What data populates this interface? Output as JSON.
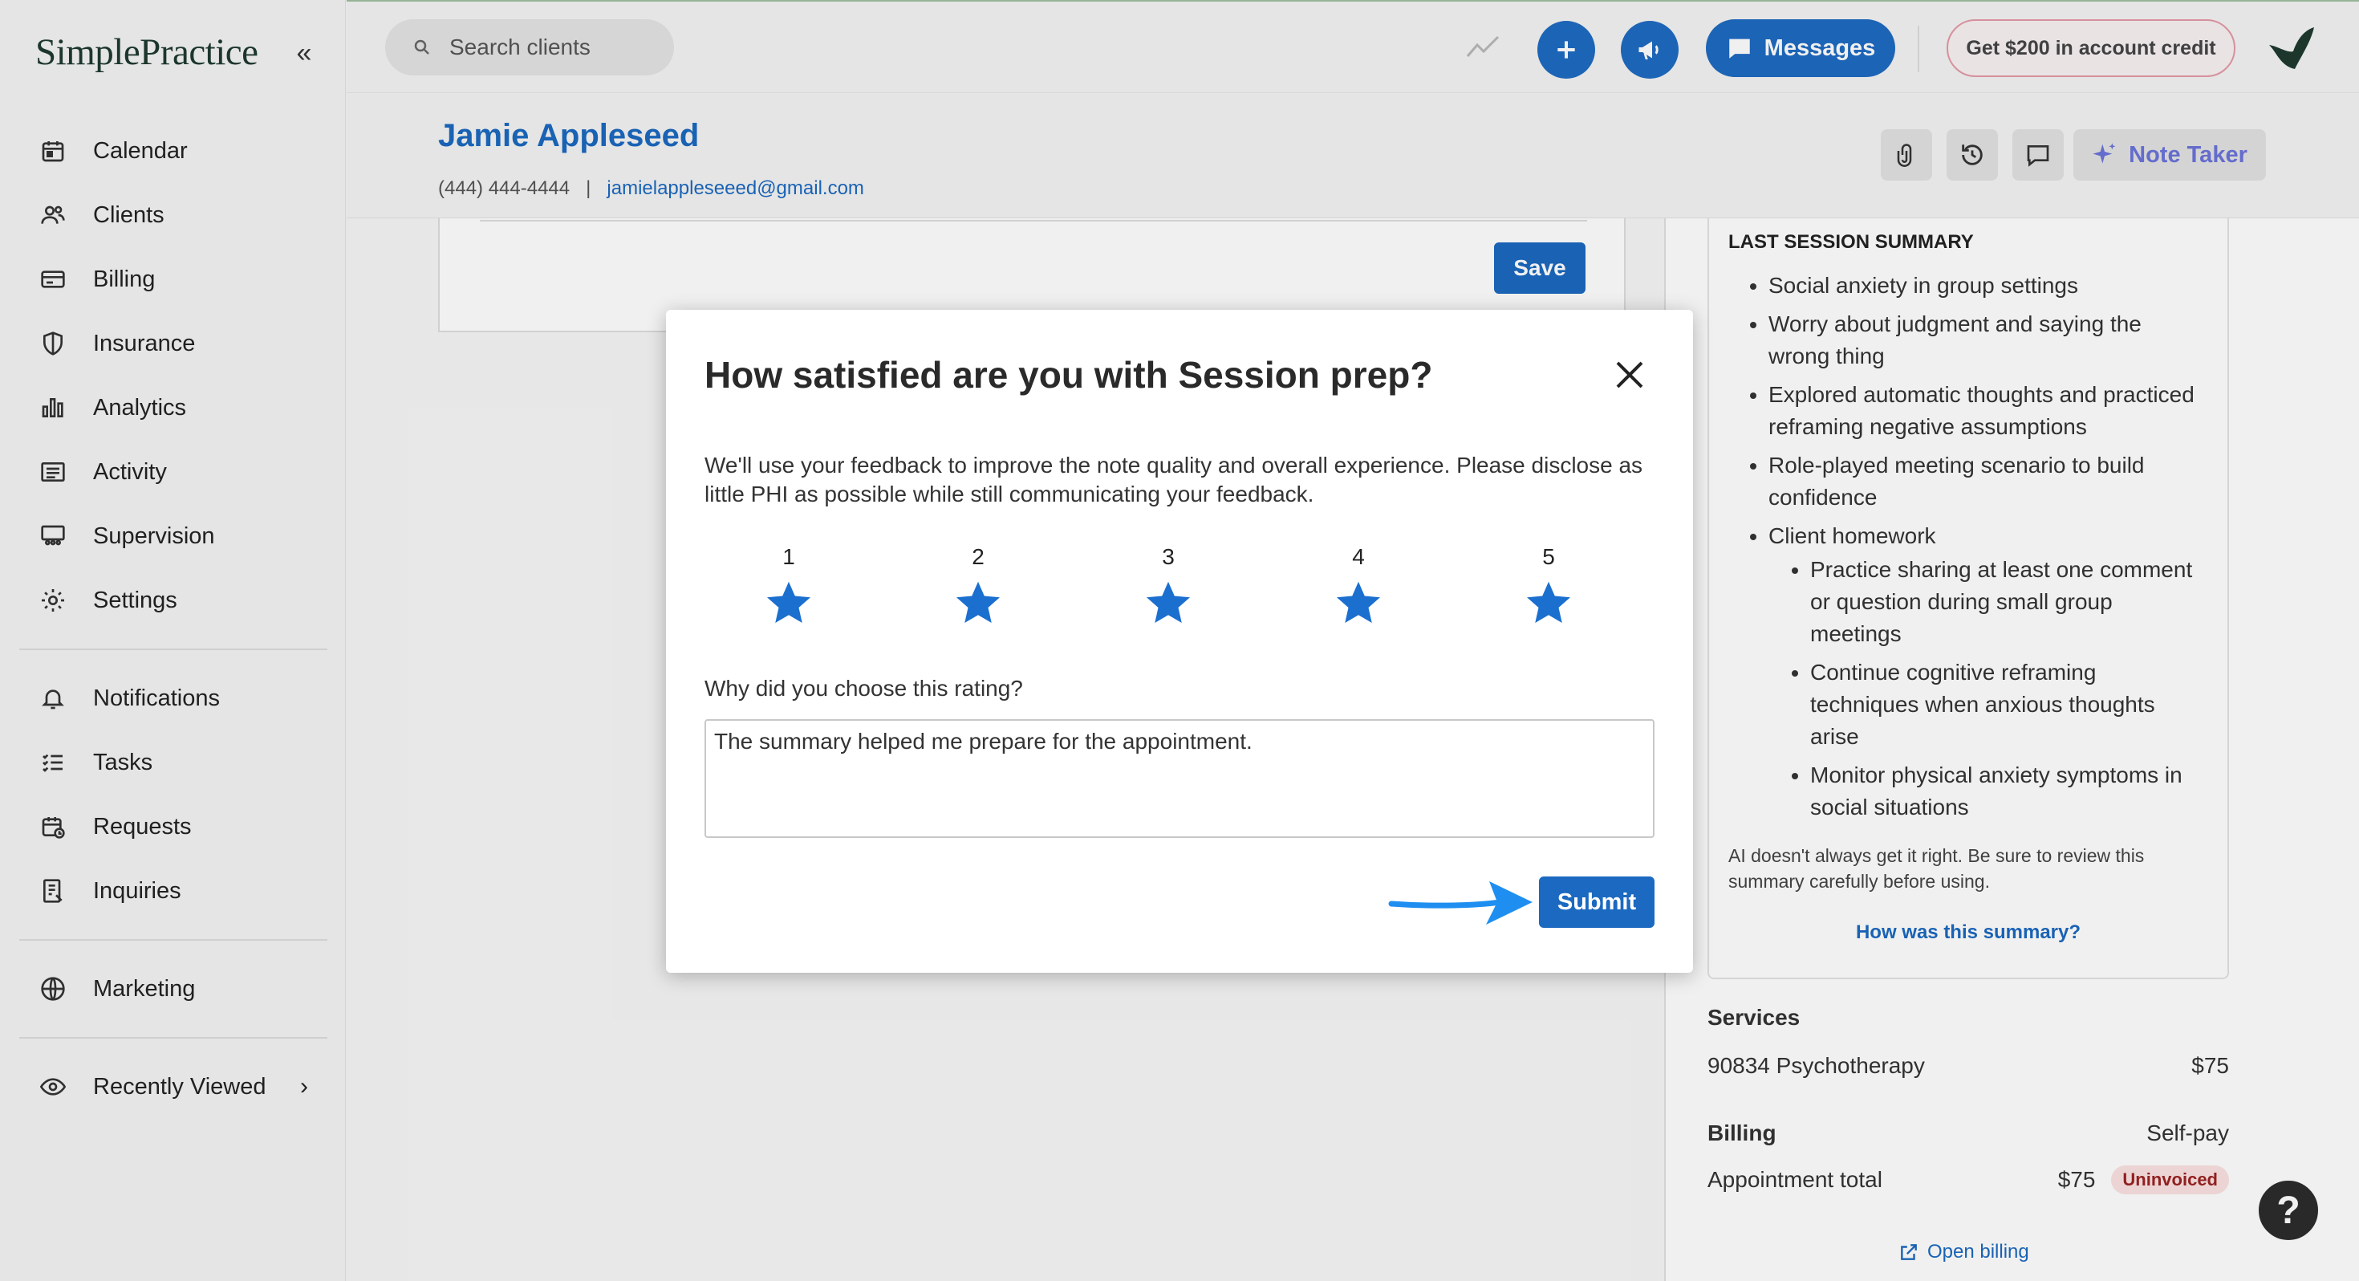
{
  "app": {
    "logo_text": "SimplePractice"
  },
  "sidebar": {
    "items": [
      {
        "label": "Calendar",
        "icon": "calendar-icon"
      },
      {
        "label": "Clients",
        "icon": "clients-icon"
      },
      {
        "label": "Billing",
        "icon": "billing-card-icon"
      },
      {
        "label": "Insurance",
        "icon": "shield-icon"
      },
      {
        "label": "Analytics",
        "icon": "bar-chart-icon"
      },
      {
        "label": "Activity",
        "icon": "activity-list-icon"
      },
      {
        "label": "Supervision",
        "icon": "supervision-icon"
      },
      {
        "label": "Settings",
        "icon": "gear-icon"
      }
    ],
    "items2": [
      {
        "label": "Notifications",
        "icon": "bell-icon"
      },
      {
        "label": "Tasks",
        "icon": "tasks-icon"
      },
      {
        "label": "Requests",
        "icon": "requests-icon"
      },
      {
        "label": "Inquiries",
        "icon": "inquiries-icon"
      }
    ],
    "items3": [
      {
        "label": "Marketing",
        "icon": "globe-icon"
      }
    ],
    "recently_viewed": "Recently Viewed"
  },
  "topbar": {
    "search_placeholder": "Search clients",
    "messages_label": "Messages",
    "credit_label": "Get $200 in account credit"
  },
  "client": {
    "name": "Jamie Appleseed",
    "phone": "(444) 444-4444",
    "separator": "|",
    "email": "jamielappleseeed@gmail.com",
    "note_taker_label": "Note Taker"
  },
  "editor": {
    "save_label": "Save"
  },
  "summary": {
    "title": "LAST SESSION SUMMARY",
    "bullets": [
      "Social anxiety in group settings",
      "Worry about judgment and saying the wrong thing",
      "Explored automatic thoughts and practiced reframing negative assumptions",
      "Role-played meeting scenario to build confidence",
      "Client homework"
    ],
    "homework": [
      "Practice sharing at least one comment or question during small group meetings",
      "Continue cognitive reframing techniques when anxious thoughts arise",
      "Monitor physical anxiety symptoms in social situations"
    ],
    "disclaimer": "AI doesn't always get it right. Be sure to review this summary carefully before using.",
    "feedback_link": "How was this summary?"
  },
  "services": {
    "title": "Services",
    "code": "90834 Psychotherapy",
    "price": "$75"
  },
  "billing": {
    "title": "Billing",
    "type": "Self-pay",
    "total_label": "Appointment total",
    "total_amount": "$75",
    "status": "Uninvoiced",
    "open_billing": "Open billing"
  },
  "help": {
    "label": "?"
  },
  "modal": {
    "title": "How satisfied are you with Session prep?",
    "description": "We'll use your feedback to improve the note quality and overall experience. Please disclose as little PHI as possible while still communicating your feedback.",
    "ratings": [
      "1",
      "2",
      "3",
      "4",
      "5"
    ],
    "question": "Why did you choose this rating?",
    "answer": "The summary helped me prepare for the appointment.",
    "submit_label": "Submit"
  },
  "colors": {
    "primary": "#1b69c0",
    "star": "#1b6fcf",
    "arrow": "#1e8ff0",
    "badge_bg": "#fbe2e2",
    "badge_text": "#9b2222",
    "note_taker": "#6b73d9"
  }
}
